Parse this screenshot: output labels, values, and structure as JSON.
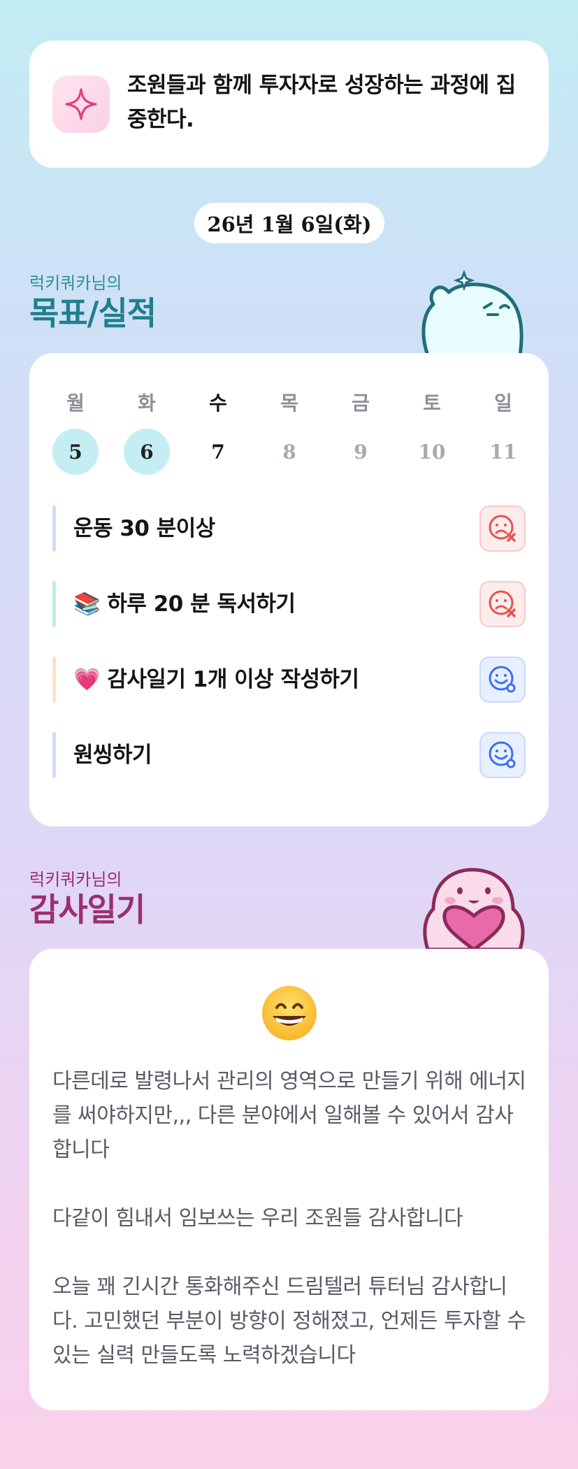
{
  "goal": {
    "text": "조원들과 함께 투자자로 성장하는 과정에 집중한다."
  },
  "date": "26년 1월 6일(화)",
  "goals_section": {
    "owner": "럭키쿼카님의",
    "title": "목표/실적"
  },
  "week": {
    "days": [
      {
        "dow": "월",
        "num": "5",
        "state": "done"
      },
      {
        "dow": "화",
        "num": "6",
        "state": "done"
      },
      {
        "dow": "수",
        "num": "7",
        "state": "today"
      },
      {
        "dow": "목",
        "num": "8",
        "state": "future"
      },
      {
        "dow": "금",
        "num": "9",
        "state": "future"
      },
      {
        "dow": "토",
        "num": "10",
        "state": "future"
      },
      {
        "dow": "일",
        "num": "11",
        "state": "future"
      }
    ]
  },
  "tasks": [
    {
      "label": "운동 30 분이상",
      "bar_color": "#d5d9fb",
      "status": "fail",
      "status_icon": "sad-face-x-icon"
    },
    {
      "label": "📚 하루 20 분 독서하기",
      "bar_color": "#bdeedd",
      "status": "fail",
      "status_icon": "sad-face-x-icon"
    },
    {
      "label": "💗 감사일기 1개 이상 작성하기",
      "bar_color": "#ffe0c7",
      "status": "ok",
      "status_icon": "smile-face-check-icon"
    },
    {
      "label": "원씽하기",
      "bar_color": "#d5d9fb",
      "status": "ok",
      "status_icon": "smile-face-check-icon"
    }
  ],
  "journal_section": {
    "owner": "럭키쿼카님의",
    "title": "감사일기"
  },
  "journal": {
    "emoji": "grinning-face-icon",
    "text": "다른데로 발령나서 관리의 영역으로 만들기 위해 에너지를 써야하지만,,, 다른 분야에서 일해볼 수 있어서 감사합니다\n\n다같이 힘내서 임보쓰는 우리 조원들 감사합니다\n\n오늘 꽤 긴시간 통화해주신 드림텔러 튜터님 감사합니다. 고민했던 부분이 방향이 정해졌고, 언제든 투자할 수 있는 실력 만들도록 노력하겠습니다"
  },
  "colors": {
    "accent_teal": "#1f7f8d",
    "accent_purple": "#9b2f6e",
    "fail_red": "#e5534b",
    "ok_blue": "#3b6ef5",
    "done_circle": "#c4eef3"
  }
}
